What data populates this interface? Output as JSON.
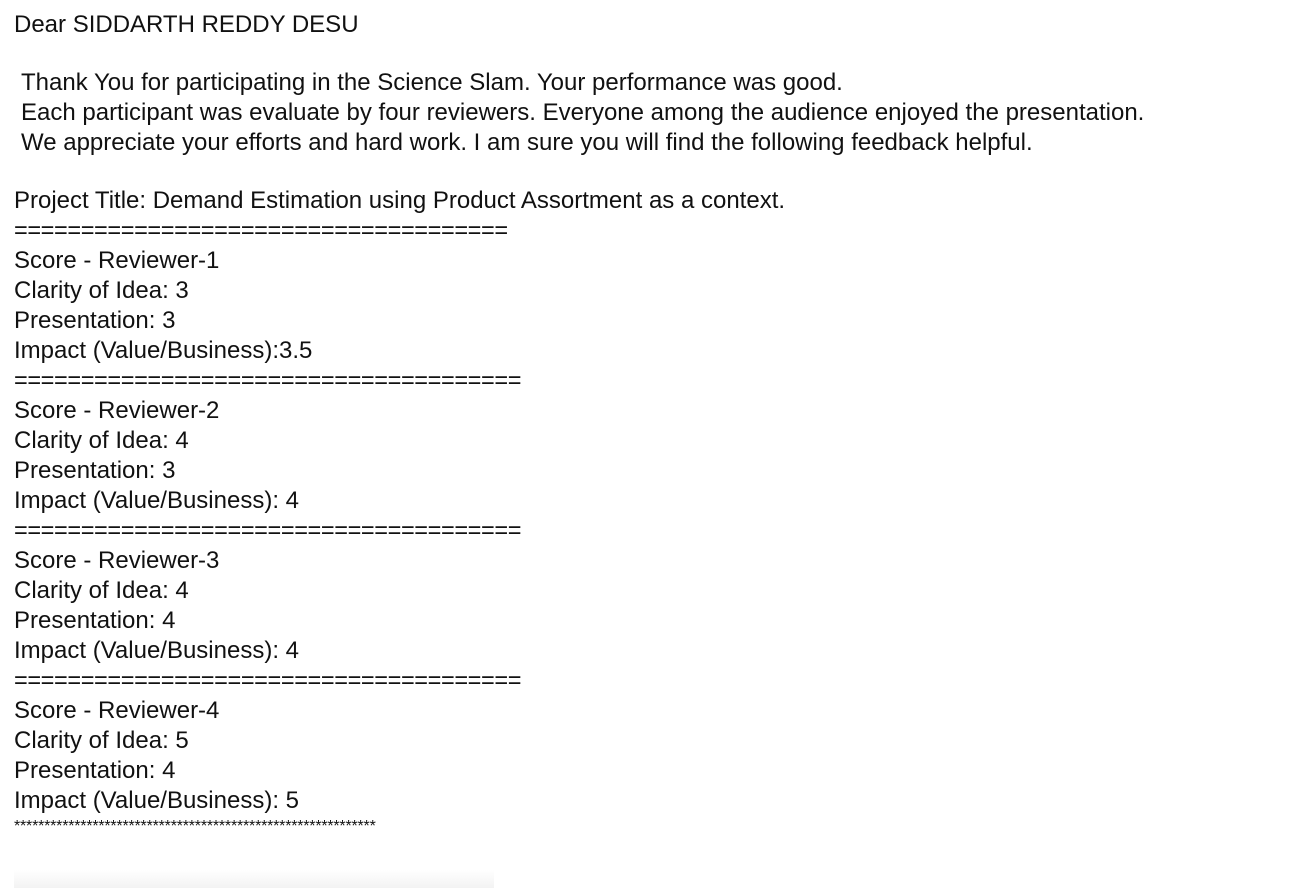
{
  "greeting": "Dear SIDDARTH REDDY DESU",
  "intro": [
    "Thank You for participating in the Science Slam. Your performance was good.",
    "Each participant was evaluate by four reviewers. Everyone among the audience enjoyed the presentation.",
    "We appreciate your efforts and hard work. I am sure you will find the following feedback helpful."
  ],
  "project_title": "Project Title: Demand Estimation using Product Assortment as a context.",
  "separators": {
    "first": "=====================================",
    "standard": "======================================",
    "stars": "************************************************************"
  },
  "reviews": [
    {
      "heading": "Score - Reviewer-1",
      "clarity": "Clarity of Idea: 3",
      "presentation": "Presentation: 3",
      "impact": "Impact (Value/Business):3.5"
    },
    {
      "heading": "Score - Reviewer-2",
      "clarity": "Clarity of Idea: 4",
      "presentation": "Presentation: 3",
      "impact": "Impact (Value/Business): 4"
    },
    {
      "heading": "Score - Reviewer-3",
      "clarity": "Clarity of Idea: 4",
      "presentation": "Presentation: 4",
      "impact": "Impact (Value/Business): 4"
    },
    {
      "heading": "Score - Reviewer-4",
      "clarity": "Clarity of Idea: 5",
      "presentation": "Presentation: 4",
      "impact": "Impact (Value/Business): 5"
    }
  ]
}
